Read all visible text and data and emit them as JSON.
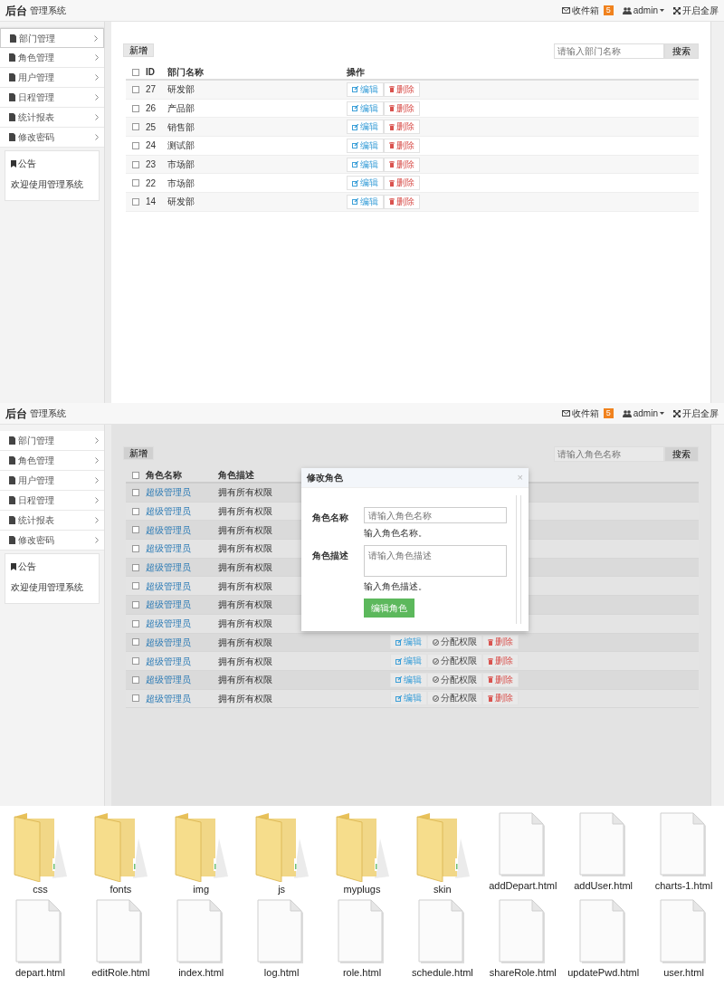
{
  "screens": [
    {
      "header": {
        "brand": "后台",
        "subtitle": "管理系统",
        "inbox": "收件箱",
        "inbox_count": "5",
        "user": "admin",
        "fullscreen": "开启全屏"
      },
      "sidebar": {
        "items": [
          {
            "label": "部门管理",
            "selected": true
          },
          {
            "label": "角色管理",
            "selected": false
          },
          {
            "label": "用户管理",
            "selected": false
          },
          {
            "label": "日程管理",
            "selected": false
          },
          {
            "label": "统计报表",
            "selected": false
          },
          {
            "label": "修改密码",
            "selected": false
          }
        ],
        "notice": {
          "title": "公告",
          "text": "欢迎使用管理系统"
        }
      },
      "toolbar": {
        "new_button": "新增",
        "search_placeholder": "请输入部门名称",
        "search_button": "搜索"
      },
      "table": {
        "header_checked": false,
        "columns": [
          {
            "label": "ID",
            "kind": "id"
          },
          {
            "label": "部门名称",
            "kind": "label"
          },
          {
            "label": "操作",
            "kind": "actions"
          }
        ],
        "rows": [
          {
            "checked": false,
            "cells": [
              "27",
              "研发部"
            ],
            "actions": [
              {
                "label": "编辑",
                "kind": "edit"
              },
              {
                "label": "删除",
                "kind": "delete"
              }
            ]
          },
          {
            "checked": false,
            "cells": [
              "26",
              "产品部"
            ],
            "actions": [
              {
                "label": "编辑",
                "kind": "edit"
              },
              {
                "label": "删除",
                "kind": "delete"
              }
            ]
          },
          {
            "checked": false,
            "cells": [
              "25",
              "销售部"
            ],
            "actions": [
              {
                "label": "编辑",
                "kind": "edit"
              },
              {
                "label": "删除",
                "kind": "delete"
              }
            ]
          },
          {
            "checked": false,
            "cells": [
              "24",
              "测试部"
            ],
            "actions": [
              {
                "label": "编辑",
                "kind": "edit"
              },
              {
                "label": "删除",
                "kind": "delete"
              }
            ]
          },
          {
            "checked": false,
            "cells": [
              "23",
              "市场部"
            ],
            "actions": [
              {
                "label": "编辑",
                "kind": "edit"
              },
              {
                "label": "删除",
                "kind": "delete"
              }
            ]
          },
          {
            "checked": false,
            "cells": [
              "22",
              "市场部"
            ],
            "actions": [
              {
                "label": "编辑",
                "kind": "edit"
              },
              {
                "label": "删除",
                "kind": "delete"
              }
            ]
          },
          {
            "checked": false,
            "cells": [
              "14",
              "研发部"
            ],
            "actions": [
              {
                "label": "编辑",
                "kind": "edit"
              },
              {
                "label": "删除",
                "kind": "delete"
              }
            ]
          }
        ]
      }
    },
    {
      "header": {
        "brand": "后台",
        "subtitle": "管理系统",
        "inbox": "收件箱",
        "inbox_count": "5",
        "user": "admin",
        "fullscreen": "开启全屏"
      },
      "sidebar": {
        "items": [
          {
            "label": "部门管理",
            "selected": false
          },
          {
            "label": "角色管理",
            "selected": false
          },
          {
            "label": "用户管理",
            "selected": false
          },
          {
            "label": "日程管理",
            "selected": false
          },
          {
            "label": "统计报表",
            "selected": false
          },
          {
            "label": "修改密码",
            "selected": false
          }
        ],
        "notice": {
          "title": "公告",
          "text": "欢迎使用管理系统"
        }
      },
      "dimmed": true,
      "toolbar": {
        "new_button": "新增",
        "search_placeholder": "请输入角色名称",
        "search_button": "搜索"
      },
      "table": {
        "header_checked": false,
        "columns": [
          {
            "label": "角色名称",
            "kind": "link"
          },
          {
            "label": "角色描述",
            "kind": "note"
          }
        ],
        "rows": [
          {
            "checked": false,
            "cells": [
              "超级管理员",
              "拥有所有权限"
            ]
          },
          {
            "checked": false,
            "cells": [
              "超级管理员",
              "拥有所有权限"
            ]
          },
          {
            "checked": false,
            "cells": [
              "超级管理员",
              "拥有所有权限"
            ]
          },
          {
            "checked": false,
            "cells": [
              "超级管理员",
              "拥有所有权限"
            ]
          },
          {
            "checked": false,
            "cells": [
              "超级管理员",
              "拥有所有权限"
            ]
          },
          {
            "checked": false,
            "cells": [
              "超级管理员",
              "拥有所有权限"
            ]
          },
          {
            "checked": false,
            "cells": [
              "超级管理员",
              "拥有所有权限"
            ]
          },
          {
            "checked": false,
            "cells": [
              "超级管理员",
              "拥有所有权限"
            ]
          },
          {
            "checked": false,
            "cells": [
              "超级管理员",
              "拥有所有权限"
            ],
            "actions": [
              {
                "label": "编辑",
                "kind": "edit"
              },
              {
                "label": "分配权限",
                "kind": "assign"
              },
              {
                "label": "删除",
                "kind": "delete"
              }
            ]
          },
          {
            "checked": false,
            "cells": [
              "超级管理员",
              "拥有所有权限"
            ],
            "actions": [
              {
                "label": "编辑",
                "kind": "edit"
              },
              {
                "label": "分配权限",
                "kind": "assign"
              },
              {
                "label": "删除",
                "kind": "delete"
              }
            ]
          },
          {
            "checked": false,
            "cells": [
              "超级管理员",
              "拥有所有权限"
            ],
            "actions": [
              {
                "label": "编辑",
                "kind": "edit"
              },
              {
                "label": "分配权限",
                "kind": "assign"
              },
              {
                "label": "删除",
                "kind": "delete"
              }
            ]
          },
          {
            "checked": false,
            "cells": [
              "超级管理员",
              "拥有所有权限"
            ],
            "actions": [
              {
                "label": "编辑",
                "kind": "edit"
              },
              {
                "label": "分配权限",
                "kind": "assign"
              },
              {
                "label": "删除",
                "kind": "delete"
              }
            ]
          }
        ]
      },
      "modal": {
        "title": "修改角色",
        "close": "×",
        "fields": [
          {
            "label": "角色名称",
            "placeholder": "请输入角色名称",
            "help": "输入角色名称。",
            "kind": "input"
          },
          {
            "label": "角色描述",
            "placeholder": "请输入角色描述",
            "help": "输入角色描述。",
            "kind": "textarea"
          }
        ],
        "submit": "编辑角色"
      }
    }
  ],
  "file_browser": {
    "items": [
      {
        "name": "css",
        "kind": "folder"
      },
      {
        "name": "fonts",
        "kind": "folder"
      },
      {
        "name": "img",
        "kind": "folder"
      },
      {
        "name": "js",
        "kind": "folder"
      },
      {
        "name": "myplugs",
        "kind": "folder"
      },
      {
        "name": "skin",
        "kind": "folder"
      },
      {
        "name": "addDepart.html",
        "kind": "file"
      },
      {
        "name": "addUser.html",
        "kind": "file"
      },
      {
        "name": "charts-1.html",
        "kind": "file"
      },
      {
        "name": "depart.html",
        "kind": "file"
      },
      {
        "name": "editRole.html",
        "kind": "file"
      },
      {
        "name": "index.html",
        "kind": "file"
      },
      {
        "name": "log.html",
        "kind": "file"
      },
      {
        "name": "role.html",
        "kind": "file"
      },
      {
        "name": "schedule.html",
        "kind": "file"
      },
      {
        "name": "shareRole.html",
        "kind": "file"
      },
      {
        "name": "updatePwd.html",
        "kind": "file"
      },
      {
        "name": "user.html",
        "kind": "file"
      }
    ]
  }
}
